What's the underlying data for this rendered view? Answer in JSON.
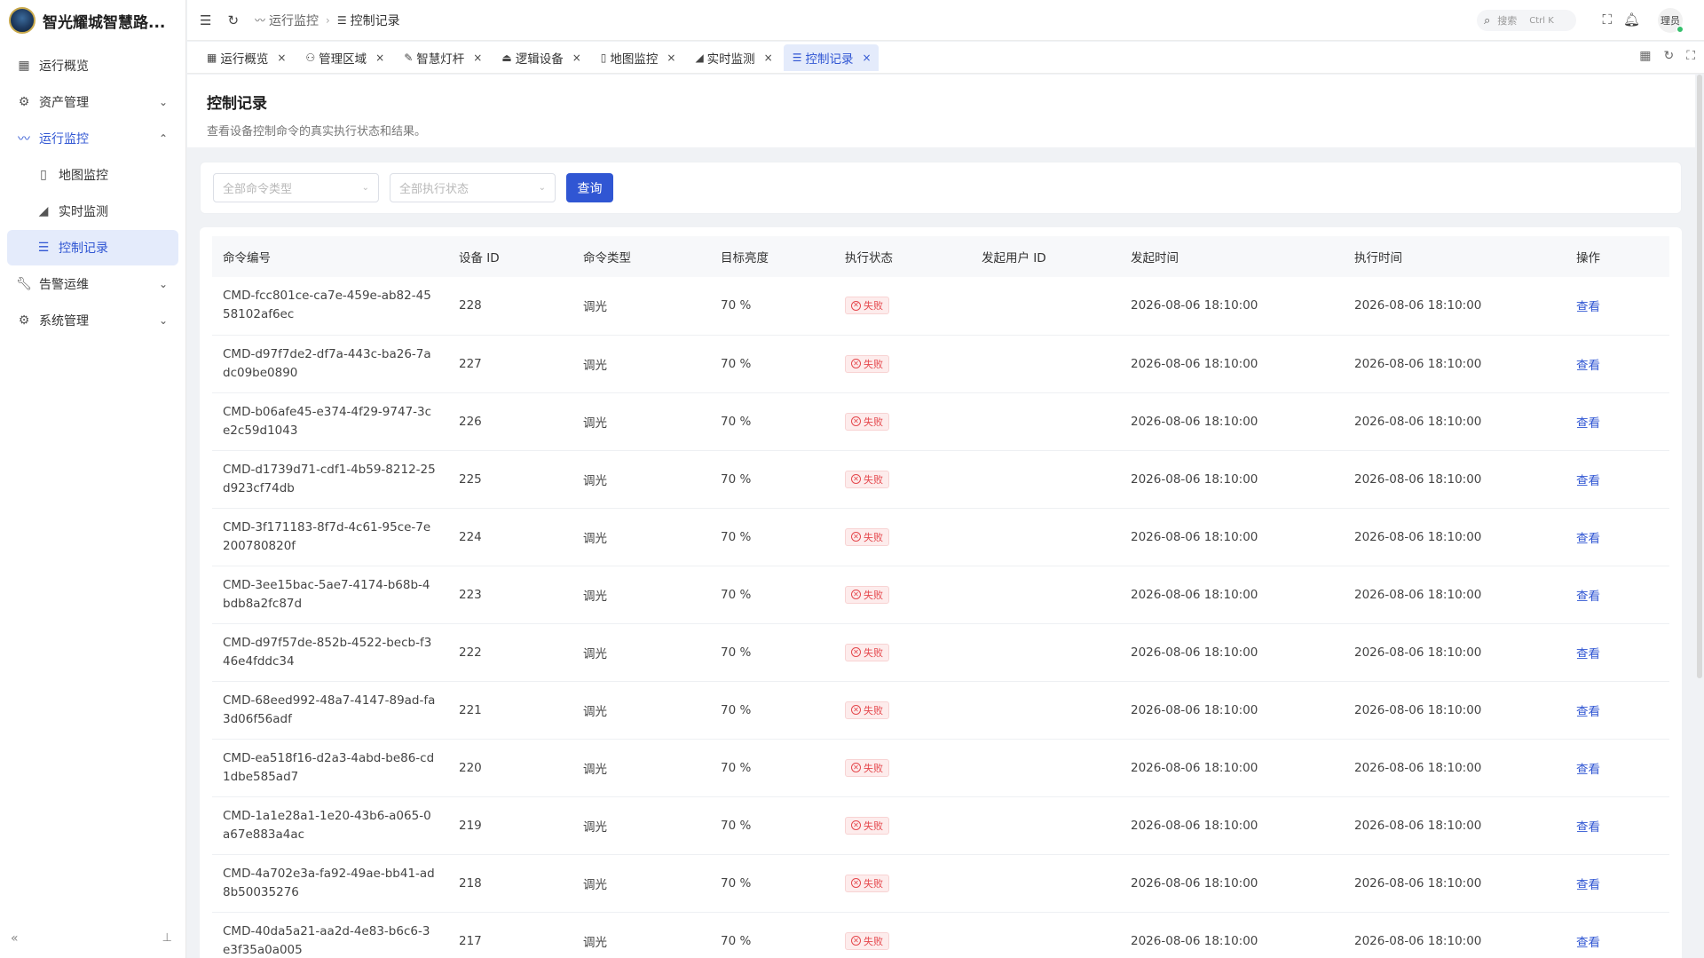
{
  "app": {
    "name": "智光耀城智慧路..."
  },
  "sidebar": {
    "items": [
      {
        "label": "运行概览",
        "icon": "grid-icon"
      },
      {
        "label": "资产管理",
        "icon": "cpu-icon"
      },
      {
        "label": "运行监控",
        "icon": "pulse-icon"
      },
      {
        "label": "地图监控",
        "icon": "map-icon"
      },
      {
        "label": "实时监测",
        "icon": "area-chart-icon"
      },
      {
        "label": "控制记录",
        "icon": "list-check-icon"
      },
      {
        "label": "告警运维",
        "icon": "wrench-icon"
      },
      {
        "label": "系统管理",
        "icon": "gear-icon"
      }
    ]
  },
  "header": {
    "breadcrumb": [
      "运行监控",
      "控制记录"
    ],
    "search_placeholder": "搜索",
    "search_shortcut": "Ctrl K",
    "avatar_text": "理员"
  },
  "tabs": [
    {
      "label": "运行概览"
    },
    {
      "label": "管理区域"
    },
    {
      "label": "智慧灯杆"
    },
    {
      "label": "逻辑设备"
    },
    {
      "label": "地图监控"
    },
    {
      "label": "实时监测"
    },
    {
      "label": "控制记录",
      "active": true
    }
  ],
  "page": {
    "title": "控制记录",
    "description": "查看设备控制命令的真实执行状态和结果。"
  },
  "filter": {
    "command_type_placeholder": "全部命令类型",
    "exec_status_placeholder": "全部执行状态",
    "query_label": "查询"
  },
  "table": {
    "columns": [
      "命令编号",
      "设备 ID",
      "命令类型",
      "目标亮度",
      "执行状态",
      "发起用户 ID",
      "发起时间",
      "执行时间",
      "操作"
    ],
    "rows": [
      {
        "cmd": "CMD-fcc801ce-ca7e-459e-ab82-4558102af6ec",
        "device": "228",
        "type": "调光",
        "brightness": "70 %",
        "status": "失败",
        "user": "",
        "start": "2026-08-06 18:10:00",
        "exec": "2026-08-06 18:10:00",
        "action": "查看"
      },
      {
        "cmd": "CMD-d97f7de2-df7a-443c-ba26-7adc09be0890",
        "device": "227",
        "type": "调光",
        "brightness": "70 %",
        "status": "失败",
        "user": "",
        "start": "2026-08-06 18:10:00",
        "exec": "2026-08-06 18:10:00",
        "action": "查看"
      },
      {
        "cmd": "CMD-b06afe45-e374-4f29-9747-3ce2c59d1043",
        "device": "226",
        "type": "调光",
        "brightness": "70 %",
        "status": "失败",
        "user": "",
        "start": "2026-08-06 18:10:00",
        "exec": "2026-08-06 18:10:00",
        "action": "查看"
      },
      {
        "cmd": "CMD-d1739d71-cdf1-4b59-8212-25d923cf74db",
        "device": "225",
        "type": "调光",
        "brightness": "70 %",
        "status": "失败",
        "user": "",
        "start": "2026-08-06 18:10:00",
        "exec": "2026-08-06 18:10:00",
        "action": "查看"
      },
      {
        "cmd": "CMD-3f171183-8f7d-4c61-95ce-7e200780820f",
        "device": "224",
        "type": "调光",
        "brightness": "70 %",
        "status": "失败",
        "user": "",
        "start": "2026-08-06 18:10:00",
        "exec": "2026-08-06 18:10:00",
        "action": "查看"
      },
      {
        "cmd": "CMD-3ee15bac-5ae7-4174-b68b-4bdb8a2fc87d",
        "device": "223",
        "type": "调光",
        "brightness": "70 %",
        "status": "失败",
        "user": "",
        "start": "2026-08-06 18:10:00",
        "exec": "2026-08-06 18:10:00",
        "action": "查看"
      },
      {
        "cmd": "CMD-d97f57de-852b-4522-becb-f346e4fddc34",
        "device": "222",
        "type": "调光",
        "brightness": "70 %",
        "status": "失败",
        "user": "",
        "start": "2026-08-06 18:10:00",
        "exec": "2026-08-06 18:10:00",
        "action": "查看"
      },
      {
        "cmd": "CMD-68eed992-48a7-4147-89ad-fa3d06f56adf",
        "device": "221",
        "type": "调光",
        "brightness": "70 %",
        "status": "失败",
        "user": "",
        "start": "2026-08-06 18:10:00",
        "exec": "2026-08-06 18:10:00",
        "action": "查看"
      },
      {
        "cmd": "CMD-ea518f16-d2a3-4abd-be86-cd1dbe585ad7",
        "device": "220",
        "type": "调光",
        "brightness": "70 %",
        "status": "失败",
        "user": "",
        "start": "2026-08-06 18:10:00",
        "exec": "2026-08-06 18:10:00",
        "action": "查看"
      },
      {
        "cmd": "CMD-1a1e28a1-1e20-43b6-a065-0a67e883a4ac",
        "device": "219",
        "type": "调光",
        "brightness": "70 %",
        "status": "失败",
        "user": "",
        "start": "2026-08-06 18:10:00",
        "exec": "2026-08-06 18:10:00",
        "action": "查看"
      },
      {
        "cmd": "CMD-4a702e3a-fa92-49ae-bb41-ad8b50035276",
        "device": "218",
        "type": "调光",
        "brightness": "70 %",
        "status": "失败",
        "user": "",
        "start": "2026-08-06 18:10:00",
        "exec": "2026-08-06 18:10:00",
        "action": "查看"
      },
      {
        "cmd": "CMD-40da5a21-aa2d-4e83-b6c6-3e3f35a0a005",
        "device": "217",
        "type": "调光",
        "brightness": "70 %",
        "status": "失败",
        "user": "",
        "start": "2026-08-06 18:10:00",
        "exec": "2026-08-06 18:10:00",
        "action": "查看"
      }
    ]
  },
  "colors": {
    "accent": "#3056d3",
    "danger": "#e5484d",
    "selected_bg": "#e4ebfb"
  }
}
